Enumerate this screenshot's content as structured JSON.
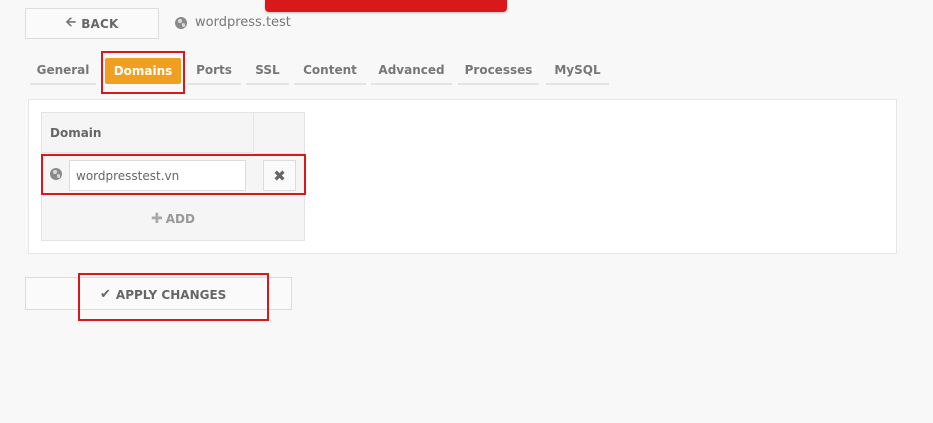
{
  "header": {
    "back_label": "BACK",
    "site_name": "wordpress.test"
  },
  "tabs": [
    {
      "label": "General",
      "active": false
    },
    {
      "label": "Domains",
      "active": true
    },
    {
      "label": "Ports",
      "active": false
    },
    {
      "label": "SSL",
      "active": false
    },
    {
      "label": "Content",
      "active": false
    },
    {
      "label": "Advanced",
      "active": false
    },
    {
      "label": "Processes",
      "active": false
    },
    {
      "label": "MySQL",
      "active": false
    }
  ],
  "domains": {
    "column_header": "Domain",
    "rows": [
      {
        "value": "wordpresstest.vn"
      }
    ],
    "add_label": "ADD"
  },
  "footer": {
    "apply_label": "APPLY CHANGES"
  },
  "colors": {
    "accent": "#f0a020",
    "highlight": "#d9181c"
  }
}
